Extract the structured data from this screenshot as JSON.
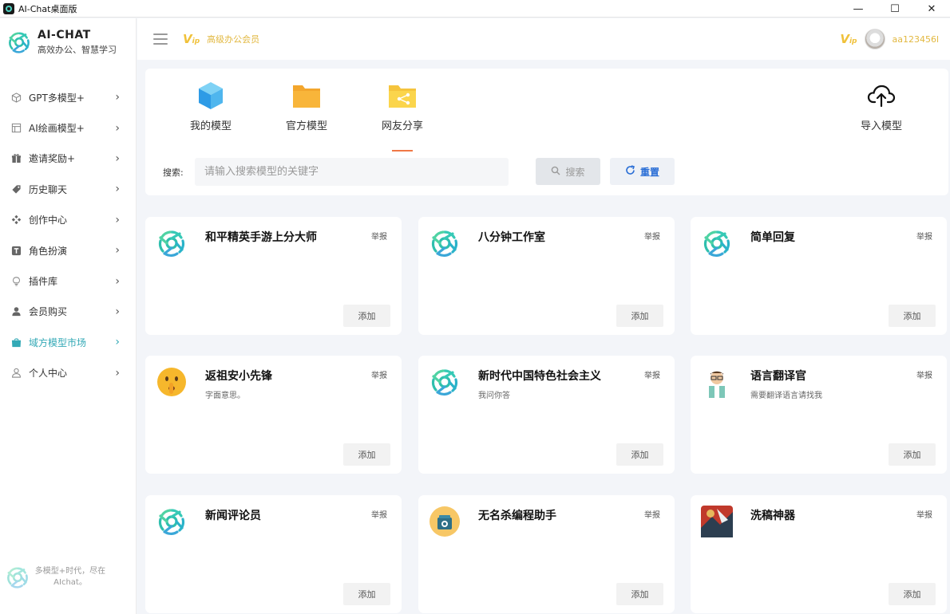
{
  "window": {
    "title": "AI-Chat桌面版",
    "minimize": "—",
    "maximize": "☐",
    "close": "✕"
  },
  "brand": {
    "name": "AI-CHAT",
    "tagline": "高效办公、智慧学习"
  },
  "nav": [
    {
      "label": "GPT多模型+",
      "icon": "cube-icon"
    },
    {
      "label": "AI绘画模型+",
      "icon": "image-icon"
    },
    {
      "label": "邀请奖励+",
      "icon": "gift-icon"
    },
    {
      "label": "历史聊天",
      "icon": "tag-icon"
    },
    {
      "label": "创作中心",
      "icon": "grid-icon"
    },
    {
      "label": "角色扮演",
      "icon": "text-icon"
    },
    {
      "label": "插件库",
      "icon": "bulb-icon"
    },
    {
      "label": "会员购买",
      "icon": "user-icon"
    },
    {
      "label": "域方模型市场",
      "icon": "bag-icon",
      "active": true
    },
    {
      "label": "个人中心",
      "icon": "person-icon"
    }
  ],
  "sidebar_footer": "多模型+时代，尽在AIchat。",
  "topbar": {
    "vip_label": "高级办公会员",
    "username": "aa123456l"
  },
  "categories": [
    {
      "label": "我的模型",
      "icon": "cube-icon"
    },
    {
      "label": "官方模型",
      "icon": "folder-icon"
    },
    {
      "label": "网友分享",
      "icon": "share-folder-icon",
      "active": true
    },
    {
      "label": "导入模型",
      "icon": "cloud-upload-icon"
    }
  ],
  "search": {
    "label": "搜索:",
    "placeholder": "请输入搜索模型的关键字",
    "search_button": "搜索",
    "reset_button": "重置"
  },
  "cards": [
    {
      "title": "和平精英手游上分大师",
      "desc": "",
      "avatar": "openai"
    },
    {
      "title": "八分钟工作室",
      "desc": "",
      "avatar": "openai"
    },
    {
      "title": "简单回复",
      "desc": "",
      "avatar": "openai"
    },
    {
      "title": "返祖安小先锋",
      "desc": "字面意思。",
      "avatar": "emoji"
    },
    {
      "title": "新时代中国特色社会主义",
      "desc": "我问你答",
      "avatar": "openai"
    },
    {
      "title": "语言翻译官",
      "desc": "需要翻译语言请找我",
      "avatar": "person"
    },
    {
      "title": "新闻评论员",
      "desc": "",
      "avatar": "openai"
    },
    {
      "title": "无名杀编程助手",
      "desc": "",
      "avatar": "pot"
    },
    {
      "title": "洗稿神器",
      "desc": "",
      "avatar": "art"
    }
  ],
  "card_report_label": "举报",
  "card_add_label": "添加",
  "colors": {
    "accent": "#33a9b6",
    "vip": "#e2b840",
    "link": "#2b6fd6",
    "underline": "#f07846"
  }
}
